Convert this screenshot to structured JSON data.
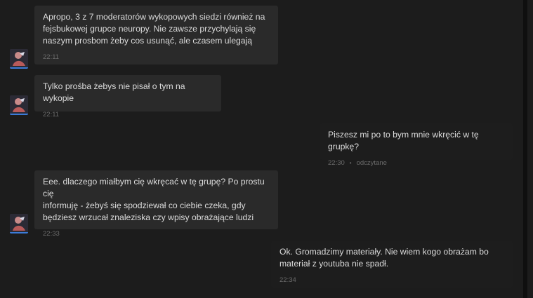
{
  "messages": [
    {
      "direction": "in",
      "text": "Apropo, 3 z 7 moderatorów wykopowych siedzi również na\nfejsbukowej grupce neuropy. Nie zawsze przychylają się\nnaszym prosbom żeby cos usunąć, ale czasem ulegają",
      "time": "22:11"
    },
    {
      "direction": "in",
      "text": "Tylko prośba żebys nie pisał o tym na wykopie",
      "time": "22:11"
    },
    {
      "direction": "out",
      "text": "Piszesz mi po to bym mnie wkręcić w tę grupkę?",
      "time": "22:30",
      "status": "odczytane"
    },
    {
      "direction": "in",
      "text": "Eee. dlaczego miałbym cię wkręcać w tę grupę? Po prostu cię\ninformuję - żebyś się spodziewał co ciebie czeka, gdy\nbędziesz wrzucał znaleziska czy wpisy obrażające ludzi",
      "time": "22:33"
    },
    {
      "direction": "out",
      "text": "Ok. Gromadzimy materiały. Nie wiem kogo obrażam bo\nmateriał z youtuba nie spadł.",
      "time": "22:34"
    }
  ],
  "colors": {
    "background": "#1c1c1c",
    "bubble_in": "#2a2a2a",
    "bubble_out": "#1d1d1d",
    "text": "#dcdcdc",
    "meta": "#6c6c6c",
    "avatar_accent": "#3b7bd8"
  },
  "icons": {
    "avatar": "user-avatar-icon"
  }
}
